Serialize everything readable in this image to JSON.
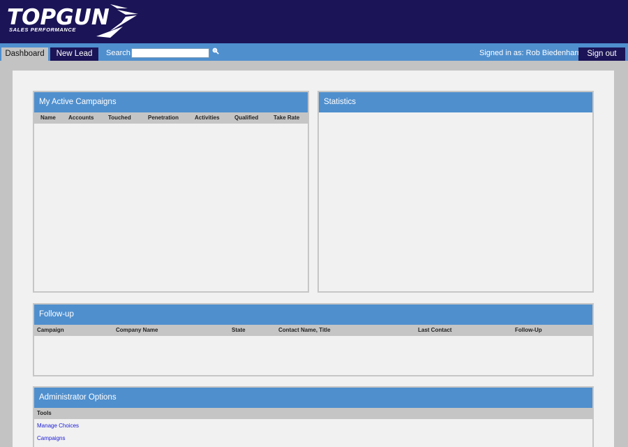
{
  "brand": {
    "logo_text": "TOPGUN",
    "logo_subtitle": "SALES PERFORMANCE"
  },
  "nav": {
    "tabs": [
      {
        "label": "Dashboard",
        "active": true
      },
      {
        "label": "New Lead",
        "active": false
      }
    ],
    "search": {
      "label": "Search",
      "value": "",
      "icon": "magnifier-icon"
    },
    "signed_in_text": "Signed in as: Rob Biedenharn",
    "sign_out_label": "Sign out"
  },
  "panels": {
    "campaigns": {
      "title": "My Active Campaigns",
      "columns": [
        "Name",
        "Accounts",
        "Touched",
        "Penetration",
        "Activities",
        "Qualified",
        "Take Rate"
      ],
      "rows": []
    },
    "statistics": {
      "title": "Statistics"
    },
    "followup": {
      "title": "Follow-up",
      "columns": [
        "Campaign",
        "Company Name",
        "State",
        "Contact Name, Title",
        "Last Contact",
        "Follow-Up"
      ],
      "rows": []
    },
    "admin": {
      "title": "Administrator Options",
      "section_label": "Tools",
      "links": [
        "Manage Choices",
        "Campaigns"
      ]
    }
  },
  "colors": {
    "header_bg": "#1b1457",
    "nav_bg": "#4f8fce",
    "panel_head_bg": "#4f8fce",
    "page_bg": "#c3c3c3",
    "content_bg": "#f1f1f1",
    "link": "#1b1bd6"
  }
}
